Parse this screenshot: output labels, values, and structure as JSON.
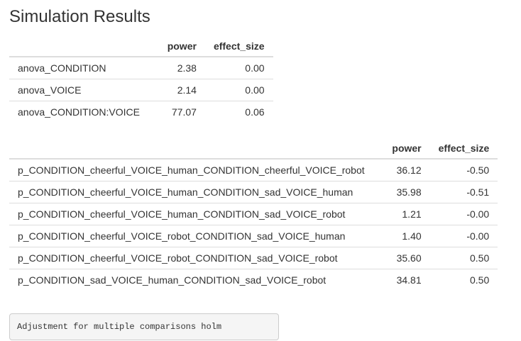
{
  "page": {
    "title": "Simulation Results"
  },
  "anova_table": {
    "headers": [
      "",
      "power",
      "effect_size"
    ],
    "rows": [
      {
        "name": "anova_CONDITION",
        "power": "2.38",
        "effect_size": "0.00"
      },
      {
        "name": "anova_VOICE",
        "power": "2.14",
        "effect_size": "0.00"
      },
      {
        "name": "anova_CONDITION:VOICE",
        "power": "77.07",
        "effect_size": "0.06"
      }
    ]
  },
  "pairwise_table": {
    "headers": [
      "",
      "power",
      "effect_size"
    ],
    "rows": [
      {
        "name": "p_CONDITION_cheerful_VOICE_human_CONDITION_cheerful_VOICE_robot",
        "power": "36.12",
        "effect_size": "-0.50"
      },
      {
        "name": "p_CONDITION_cheerful_VOICE_human_CONDITION_sad_VOICE_human",
        "power": "35.98",
        "effect_size": "-0.51"
      },
      {
        "name": "p_CONDITION_cheerful_VOICE_human_CONDITION_sad_VOICE_robot",
        "power": "1.21",
        "effect_size": "-0.00"
      },
      {
        "name": "p_CONDITION_cheerful_VOICE_robot_CONDITION_sad_VOICE_human",
        "power": "1.40",
        "effect_size": "-0.00"
      },
      {
        "name": "p_CONDITION_cheerful_VOICE_robot_CONDITION_sad_VOICE_robot",
        "power": "35.60",
        "effect_size": "0.50"
      },
      {
        "name": "p_CONDITION_sad_VOICE_human_CONDITION_sad_VOICE_robot",
        "power": "34.81",
        "effect_size": "0.50"
      }
    ]
  },
  "note": {
    "text": "Adjustment for multiple comparisons holm"
  }
}
